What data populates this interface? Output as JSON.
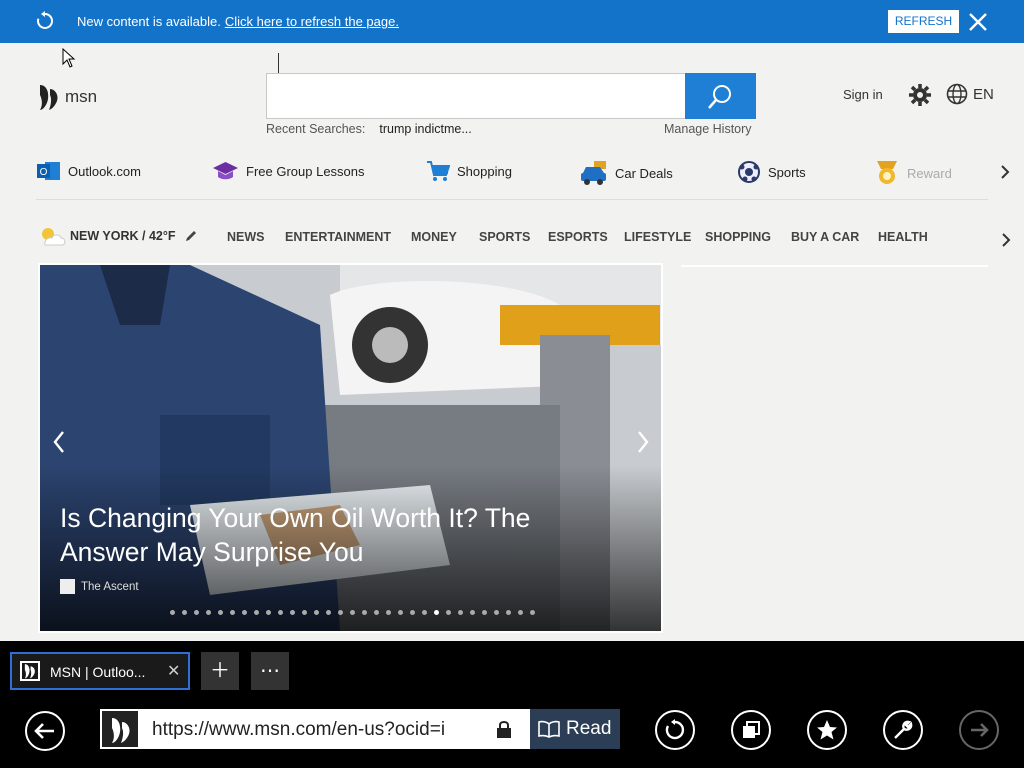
{
  "notification": {
    "message": "New content is available.",
    "link": "Click here to refresh the page.",
    "refresh_label": "REFRESH"
  },
  "header": {
    "logo_text": "msn",
    "search_placeholder": "",
    "recent_label": "Recent Searches:",
    "recent_item": "trump indictme...",
    "manage_history": "Manage History",
    "sign_in": "Sign in",
    "language": "EN"
  },
  "quick_links": [
    {
      "label": "Outlook.com",
      "icon": "outlook-icon"
    },
    {
      "label": "Free Group Lessons",
      "icon": "graduation-cap-icon"
    },
    {
      "label": "Shopping",
      "icon": "shopping-cart-icon"
    },
    {
      "label": "Car Deals",
      "icon": "car-icon"
    },
    {
      "label": "Sports",
      "icon": "soccer-ball-icon"
    },
    {
      "label": "Reward",
      "icon": "medal-icon"
    }
  ],
  "category_nav": {
    "weather": "NEW YORK / 42°F",
    "items": [
      "NEWS",
      "ENTERTAINMENT",
      "MONEY",
      "SPORTS",
      "ESPORTS",
      "LIFESTYLE",
      "SHOPPING",
      "BUY A CAR",
      "HEALTH"
    ]
  },
  "hero": {
    "headline": "Is Changing Your Own Oil Worth It? The Answer May Surprise You",
    "source": "The Ascent",
    "slide_count": 31,
    "active_slide": 22
  },
  "browser": {
    "tab_title": "MSN | Outloo...",
    "url": "https://www.msn.com/en-us?ocid=i",
    "read_label": "Read",
    "accent": "#1373c9"
  }
}
